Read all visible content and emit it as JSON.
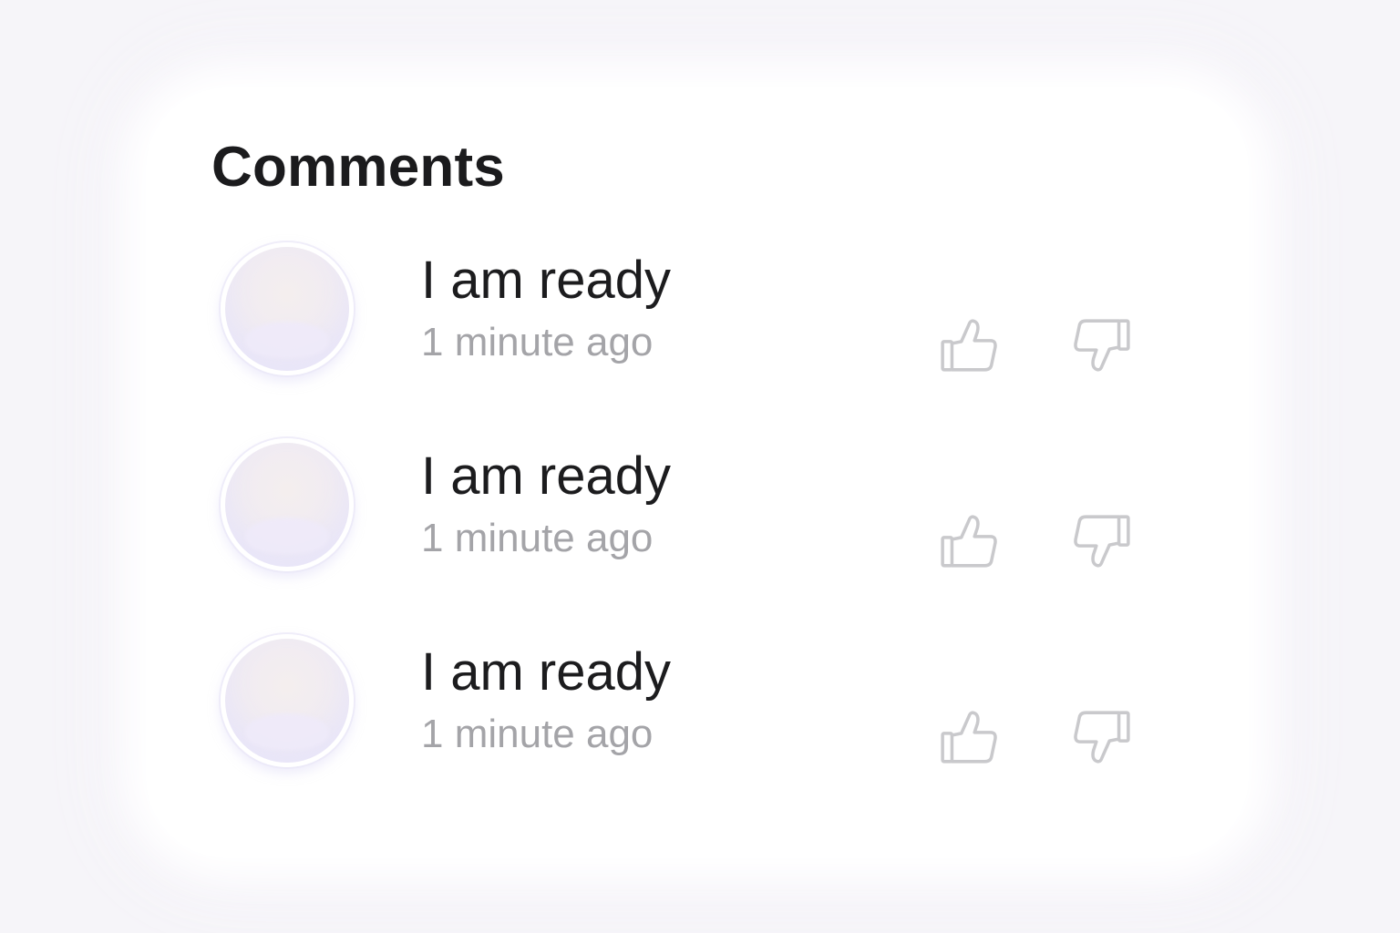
{
  "panel": {
    "title": "Comments"
  },
  "comments": [
    {
      "text": "I am ready",
      "time": "1 minute ago",
      "avatar": "avatar-placeholder"
    },
    {
      "text": "I am ready",
      "time": "1 minute ago",
      "avatar": "avatar-placeholder"
    },
    {
      "text": "I am ready",
      "time": "1 minute ago",
      "avatar": "avatar-placeholder"
    }
  ],
  "icons": {
    "like": "thumbs-up-icon",
    "dislike": "thumbs-down-icon"
  },
  "colors": {
    "background": "#f6f5f9",
    "card": "#ffffff",
    "text_primary": "#1c1c1e",
    "text_secondary": "#a4a4a8",
    "icon": "#c9c9cc"
  }
}
